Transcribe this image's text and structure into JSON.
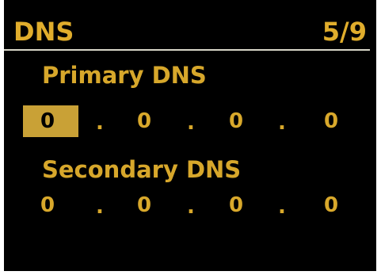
{
  "header": {
    "title": "DNS",
    "page_indicator": "5/9"
  },
  "primary_dns": {
    "label": "Primary DNS",
    "octets": [
      "0",
      "0",
      "0",
      "0"
    ],
    "selected_octet": 0
  },
  "secondary_dns": {
    "label": "Secondary DNS",
    "octets": [
      "0",
      "0",
      "0",
      "0"
    ]
  },
  "separator": ".",
  "colors": {
    "background": "#000000",
    "text": "#d9a92a",
    "highlight": "#c9a136",
    "divider": "#d8d6c8"
  }
}
